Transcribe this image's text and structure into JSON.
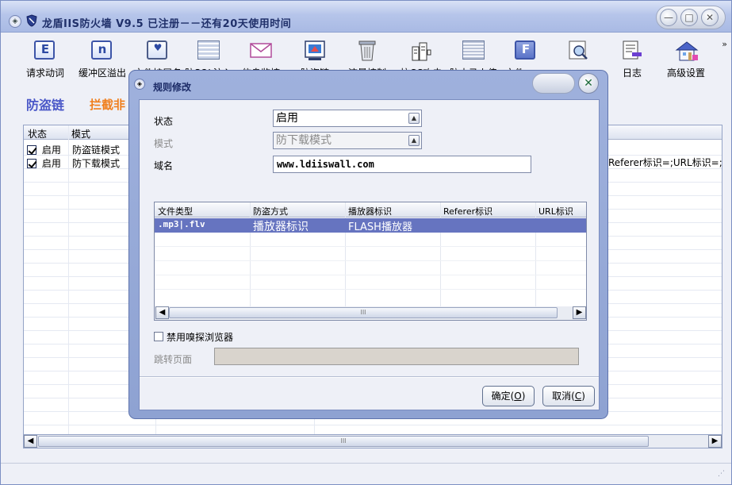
{
  "window": {
    "title": "龙盾IIS防火墙 V9.5 已注册－－还有20天使用时间"
  },
  "toolbar": {
    "items": [
      {
        "label": "请求动词",
        "icon": "request-verb-icon"
      },
      {
        "label": "缓冲区溢出",
        "icon": "buffer-overflow-icon"
      },
      {
        "label": "文件扩展名",
        "icon": "file-extension-icon"
      },
      {
        "label": "防SQL注入",
        "icon": "sql-injection-icon"
      },
      {
        "label": "信息监控",
        "icon": "mail-monitor-icon"
      },
      {
        "label": "防盗链",
        "icon": "hotlink-icon"
      },
      {
        "label": "流量控制",
        "icon": "traffic-control-icon"
      },
      {
        "label": "抗CC攻击",
        "icon": "anti-cc-icon"
      },
      {
        "label": "防木马上传",
        "icon": "trojan-upload-icon"
      },
      {
        "label": "文件",
        "icon": "file-icon"
      },
      {
        "label": "",
        "icon": "search-report-icon"
      },
      {
        "label": "日志",
        "icon": "log-icon"
      },
      {
        "label": "高级设置",
        "icon": "house-settings-icon"
      }
    ],
    "more": "»"
  },
  "page": {
    "heading": "防盗链",
    "subheading": "拦截非"
  },
  "main_list": {
    "columns": [
      "状态",
      "模式"
    ],
    "rows": [
      {
        "checked": true,
        "status": "启用",
        "mode": "防盗链模式"
      },
      {
        "checked": true,
        "status": "启用",
        "mode": "防下载模式"
      }
    ],
    "right_text": "Referer标识=;URL标识=;"
  },
  "dialog": {
    "title": "规则修改",
    "fields": {
      "status_label": "状态",
      "status_value": "启用",
      "mode_label": "模式",
      "mode_value": "防下载模式",
      "domain_label": "域名",
      "domain_value": "www.ldiiswall.com"
    },
    "grid": {
      "columns": [
        "文件类型",
        "防盗方式",
        "播放器标识",
        "Referer标识",
        "URL标识"
      ],
      "selected_row": {
        "file_type": ".mp3|.flv",
        "method": "播放器标识",
        "player_id": "FLASH播放器",
        "referer": "",
        "url": ""
      }
    },
    "sniff_label": "禁用嗅探浏览器",
    "sniff_checked": false,
    "jump_label": "跳转页面",
    "ok_label": "确定(",
    "ok_key": "O",
    "ok_end": ")",
    "cancel_label": "取消(",
    "cancel_key": "C",
    "cancel_end": ")"
  },
  "scroll": {
    "thumb_glyph": "III"
  }
}
